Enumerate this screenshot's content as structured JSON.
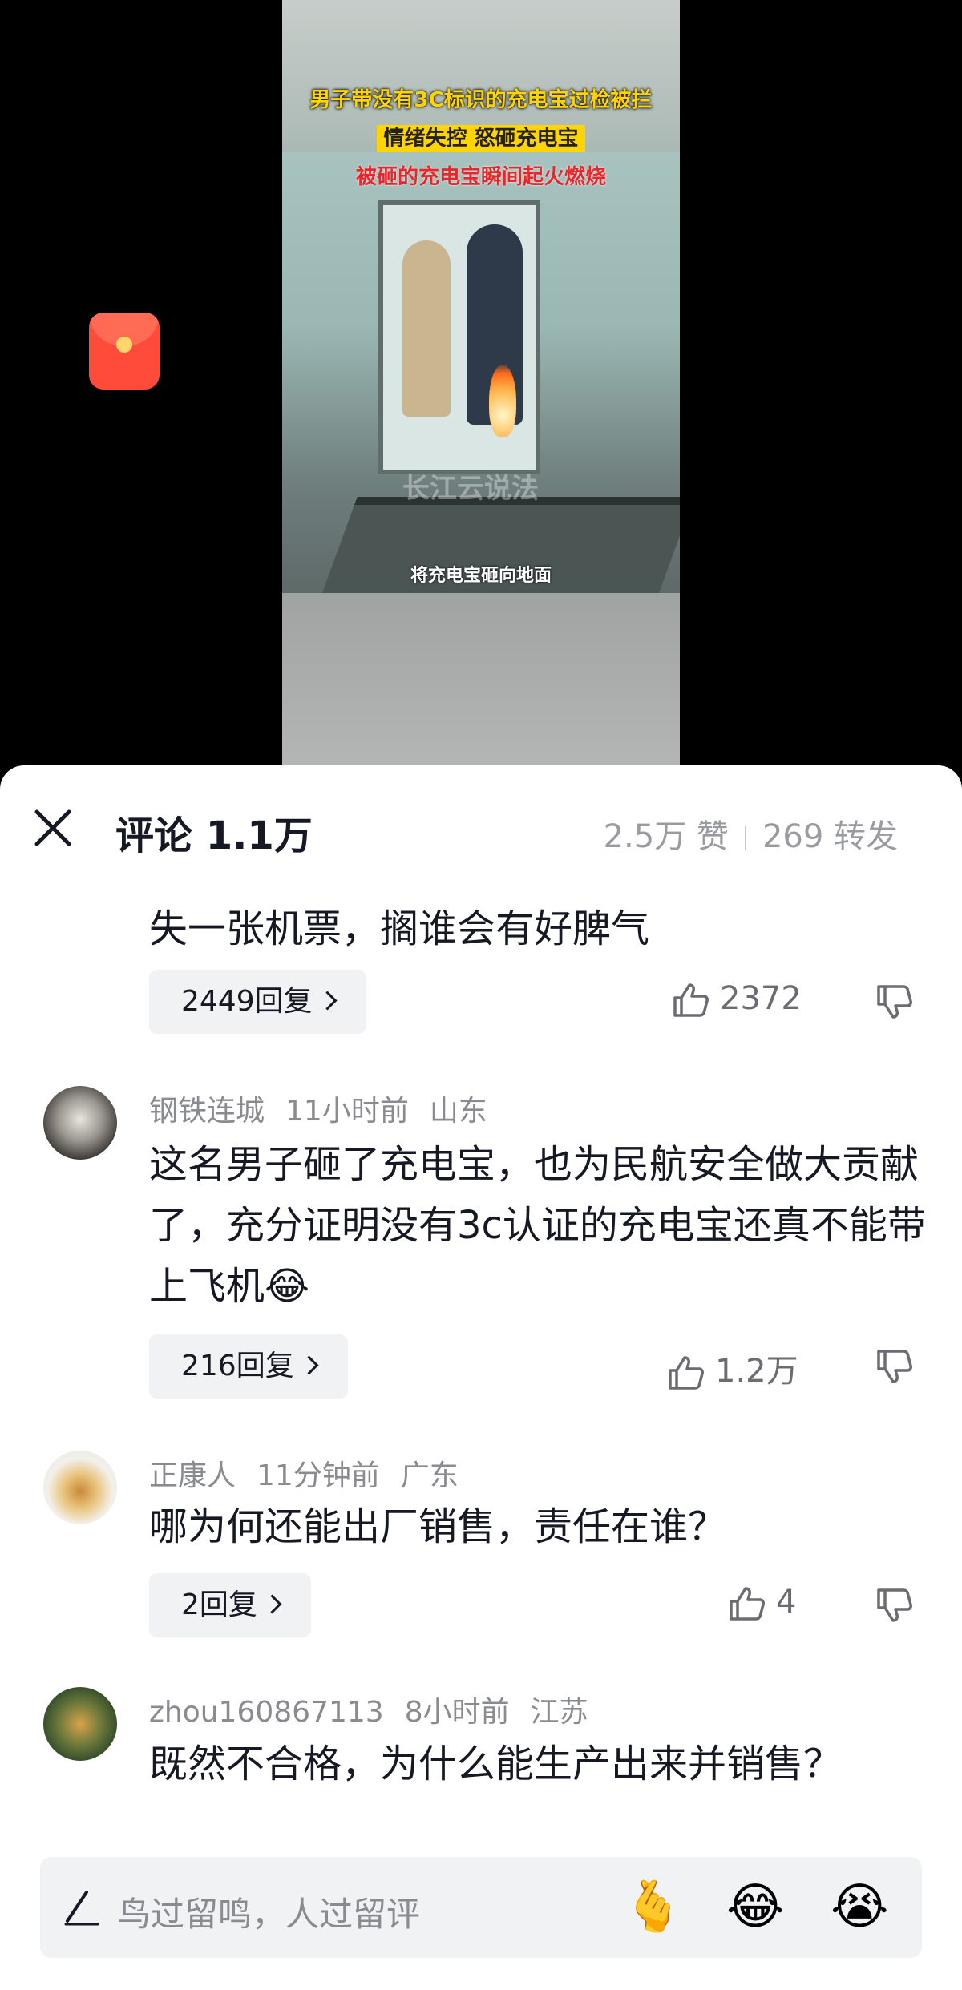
{
  "video": {
    "caption_line1": "男子带没有3C标识的充电宝过检被拦",
    "caption_line2": "情绪失控 怒砸充电宝",
    "caption_line3": "被砸的充电宝瞬间起火燃烧",
    "subtitle": "将充电宝砸向地面",
    "watermark": "长江云说法"
  },
  "header": {
    "title": "评论 1.1万",
    "likes": "2.5万 赞",
    "shares": "269 转发"
  },
  "comments": [
    {
      "text": "失一张机票，搁谁会有好脾气",
      "reply_label": "2449回复",
      "likes": "2372"
    },
    {
      "user": "钢铁连城",
      "time": "11小时前",
      "location": "山东",
      "text": "这名男子砸了充电宝，也为民航安全做大贡献了，充分证明没有3c认证的充电宝还真不能带上飞机😂",
      "reply_label": "216回复",
      "likes": "1.2万"
    },
    {
      "user": "正康人",
      "time": "11分钟前",
      "location": "广东",
      "text": "哪为何还能出厂销售，责任在谁？",
      "reply_label": "2回复",
      "likes": "4"
    },
    {
      "user": "zhou160867113",
      "time": "8小时前",
      "location": "江苏",
      "text": "既然不合格，为什么能生产出来并销售？"
    }
  ],
  "input": {
    "placeholder": "鸟过留鸣，人过留评",
    "emojis": [
      "🫰",
      "😂",
      "😭"
    ]
  },
  "colors": {
    "caption_yellow": "#ffd400",
    "caption_red": "#e8272c",
    "redpacket": "#ff4b3a"
  }
}
